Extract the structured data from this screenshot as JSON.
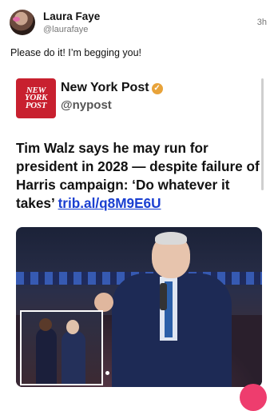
{
  "post": {
    "author_name": "Laura Faye",
    "author_handle": "@laurafaye",
    "timestamp": "3h",
    "text": "Please do it! I’m begging you!"
  },
  "quoted": {
    "logo_text": [
      "NEW",
      "YORK",
      "POST"
    ],
    "source_name": "New York Post",
    "source_handle": "@nypost",
    "verified_icon": "verified-badge-icon",
    "headline": "Tim Walz says he may run for president in 2028 — despite failure of Harris campaign: ‘Do whatever it takes’",
    "link": "trib.al/q8M9E6U"
  },
  "colors": {
    "logo_red": "#c8202f",
    "link_blue": "#1a3fd1",
    "verified_gold": "#e8a33a",
    "fab_pink": "#ee3d6e"
  }
}
